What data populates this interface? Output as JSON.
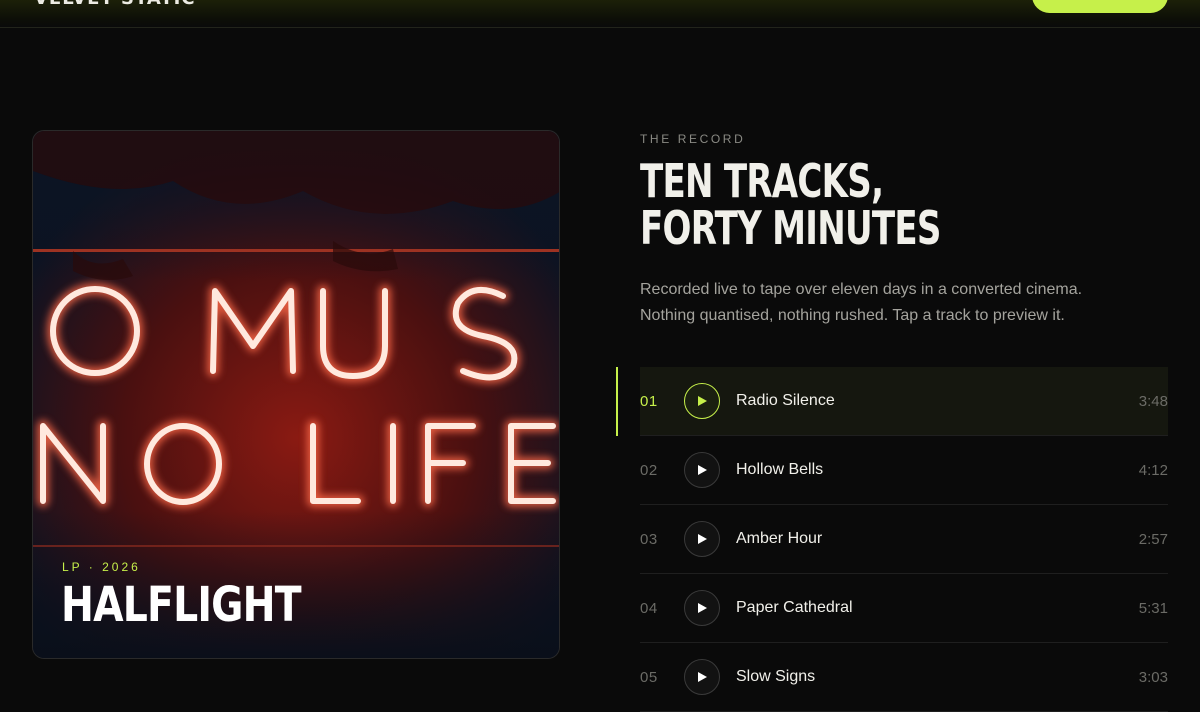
{
  "header": {
    "brand": "VELVET STATIC",
    "cta_label": ""
  },
  "cover": {
    "eyebrow": "LP · 2026",
    "title": "HALFLIGHT",
    "neon_line1": "O MUS",
    "neon_line2": "NO LIFE"
  },
  "section": {
    "eyebrow": "THE RECORD",
    "title_line1": "TEN TRACKS,",
    "title_line2": "FORTY MINUTES",
    "intro_line1": "Recorded live to tape over eleven days in a converted cinema.",
    "intro_line2": "Nothing quantised, nothing rushed. Tap a track to preview it."
  },
  "tracks": [
    {
      "num": "01",
      "title": "Radio Silence",
      "duration": "3:48",
      "active": true
    },
    {
      "num": "02",
      "title": "Hollow Bells",
      "duration": "4:12",
      "active": false
    },
    {
      "num": "03",
      "title": "Amber Hour",
      "duration": "2:57",
      "active": false
    },
    {
      "num": "04",
      "title": "Paper Cathedral",
      "duration": "5:31",
      "active": false
    },
    {
      "num": "05",
      "title": "Slow Signs",
      "duration": "3:03",
      "active": false
    }
  ],
  "colors": {
    "accent": "#c6f04a",
    "background": "#0a0a0a",
    "neon": "#ff5a3c"
  },
  "icons": {
    "play": "play-icon"
  }
}
